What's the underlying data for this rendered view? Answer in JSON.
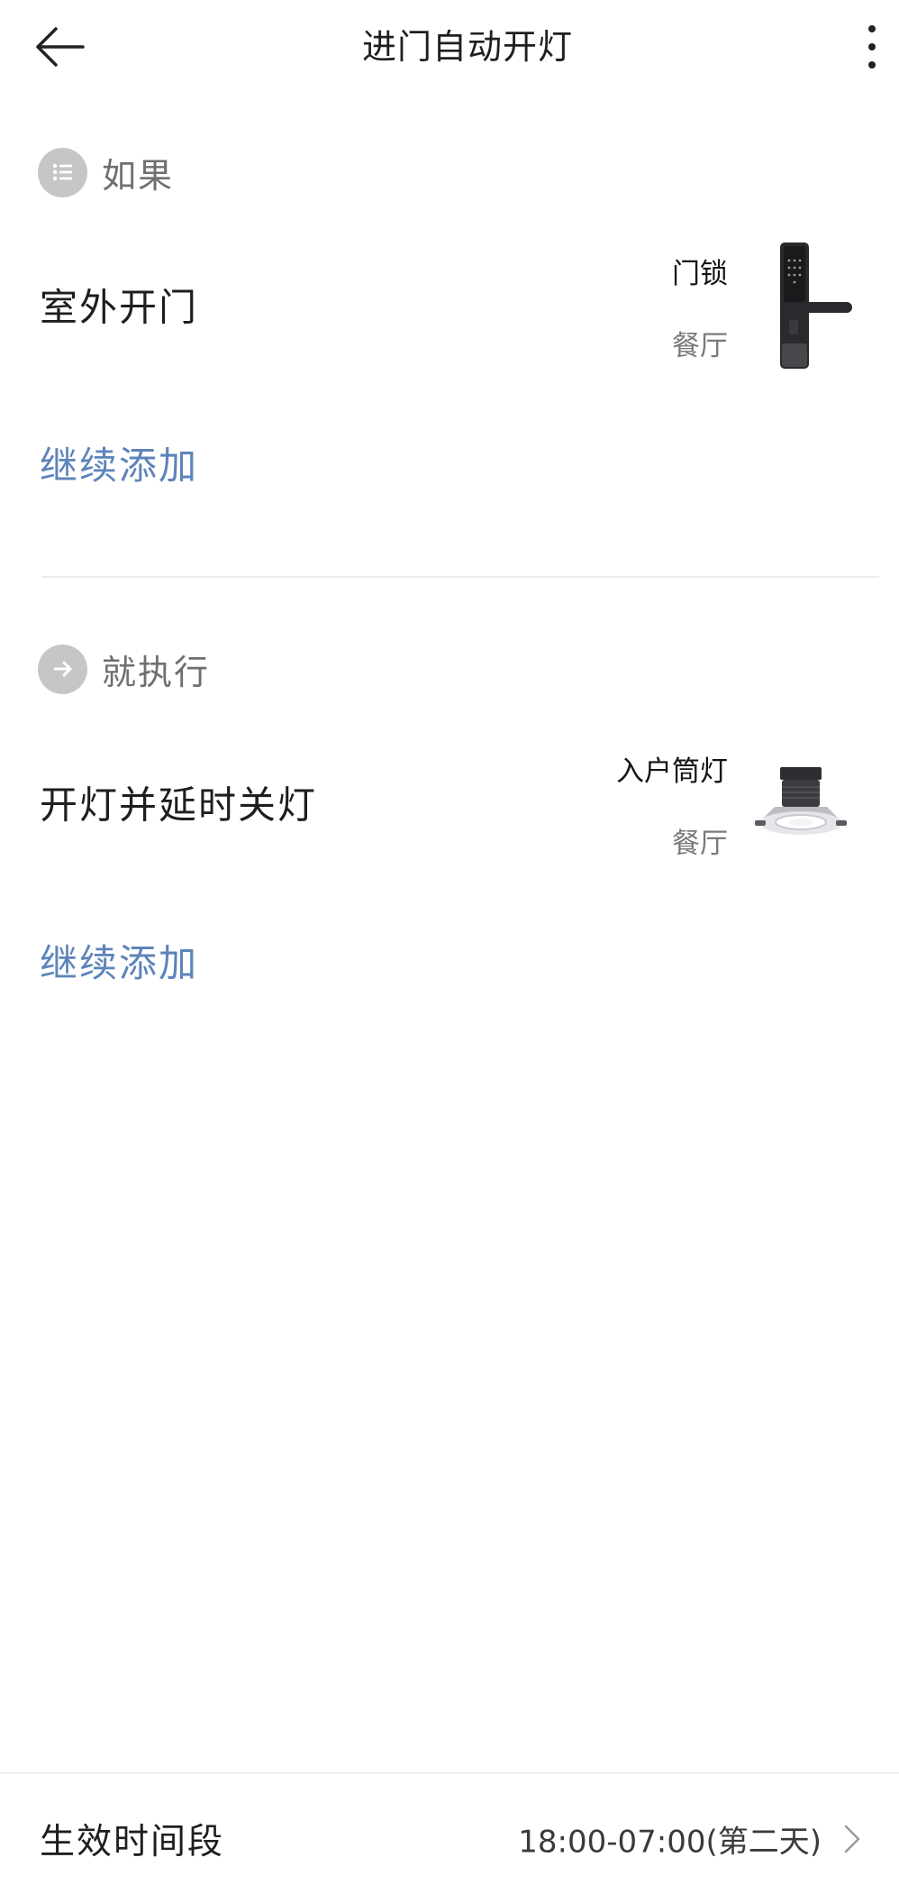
{
  "header": {
    "title": "进门自动开灯",
    "back_icon": "arrow-left-icon",
    "more_icon": "more-vertical-icon"
  },
  "if_section": {
    "title": "如果",
    "icon": "list-icon",
    "condition": {
      "name": "室外开门",
      "device": "门锁",
      "room": "餐厅",
      "image": "door-lock-image"
    },
    "add_more": "继续添加"
  },
  "then_section": {
    "title": "就执行",
    "icon": "arrow-right-icon",
    "action": {
      "name": "开灯并延时关灯",
      "device": "入户筒灯",
      "room": "餐厅",
      "image": "downlight-image"
    },
    "add_more": "继续添加"
  },
  "bottom": {
    "label": "生效时间段",
    "value": "18:00-07:00(第二天)",
    "chevron_icon": "chevron-right-icon"
  },
  "colors": {
    "accent_link": "#5d84ba",
    "section_icon_bg": "#c6c6c6"
  }
}
